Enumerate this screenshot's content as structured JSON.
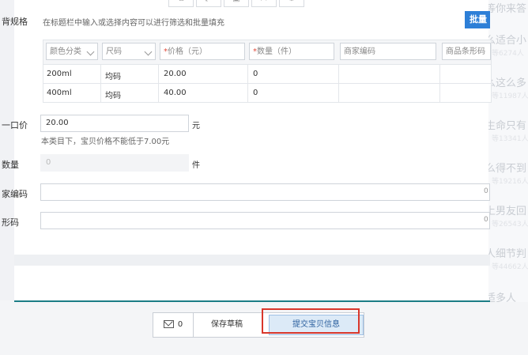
{
  "sales_spec": {
    "label_fragment": "背规格",
    "hint": "在标题栏中输入或选择内容可以进行筛选和批量填充",
    "batch_button": "批量"
  },
  "toolbar": {
    "icons": [
      "copy-icon",
      "expand-icon",
      "save-icon",
      "export-icon",
      "settings-icon"
    ]
  },
  "spec_table": {
    "headers": [
      {
        "label": "颜色分类",
        "required": false,
        "dropdown": true
      },
      {
        "label": "尺码",
        "required": false,
        "dropdown": true
      },
      {
        "label": "价格（元）",
        "required": true,
        "dropdown": false
      },
      {
        "label": "数量（件）",
        "required": true,
        "dropdown": false
      },
      {
        "label": "商家编码",
        "required": false,
        "dropdown": false
      },
      {
        "label": "商品条形码",
        "required": false,
        "dropdown": false
      }
    ],
    "required_mark": "*",
    "rows": [
      {
        "color": "200ml",
        "size": "均码",
        "price": "20.00",
        "quantity": "0"
      },
      {
        "color": "400ml",
        "size": "均码",
        "price": "40.00",
        "quantity": "0"
      }
    ]
  },
  "price": {
    "label_fragment": "一口价",
    "value": "20.00",
    "unit": "元",
    "hint": "本类目下，宝贝价格不能低于7.00元"
  },
  "quantity": {
    "label_fragment": "数量",
    "value": "0",
    "unit": "件"
  },
  "merchant_code": {
    "label_fragment": "家编码",
    "counter": "0"
  },
  "barcode": {
    "label_fragment": "形码",
    "counter": "0"
  },
  "footer": {
    "message_count": "0",
    "save_draft": "保存草稿",
    "submit": "提交宝贝信息"
  },
  "background_panel": {
    "title": "等你来答",
    "items": [
      {
        "title": "么适合小",
        "sub": "等6274人"
      },
      {
        "title": "么这么多",
        "sub": "等11987人"
      },
      {
        "title": "生命只有",
        "sub": "等13341人"
      },
      {
        "title": "么得不到",
        "sub": "等19216人"
      },
      {
        "title": "上男友回",
        "sub": "等26543人"
      },
      {
        "title": "人细节判",
        "sub": "等44662人"
      },
      {
        "title": "适多人",
        "sub": ""
      }
    ]
  }
}
